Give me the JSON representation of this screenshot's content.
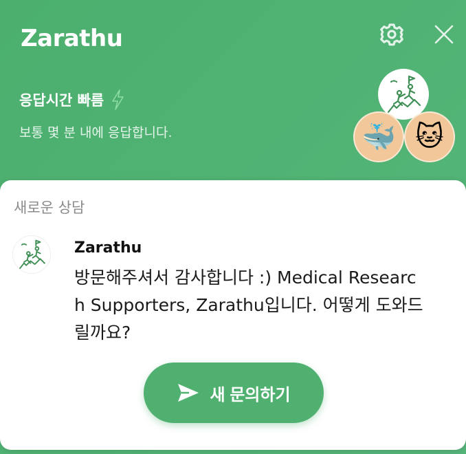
{
  "header": {
    "brand": "Zarathu",
    "status_title": "응답시간 빠름",
    "status_subtitle": "보통 몇 분 내에 응답합니다.",
    "icons": [
      "gear-icon",
      "close-icon",
      "lightning-icon"
    ],
    "accent_color": "#4caf6e"
  },
  "avatars": [
    {
      "name": "team-avatar",
      "icon": "climbing-team-icon"
    },
    {
      "name": "whale-avatar",
      "emoji": "🐳"
    },
    {
      "name": "cat-avatar",
      "emoji": "🐱"
    }
  ],
  "conversation": {
    "title": "새로운 상담",
    "sender": "Zarathu",
    "message": "방문해주셔서 감사합니다 :) Medical Research Supporters, Zarathu입니다. 어떻게 도와드릴까요?"
  },
  "cta": {
    "label": "새 문의하기",
    "icon": "send-icon"
  }
}
